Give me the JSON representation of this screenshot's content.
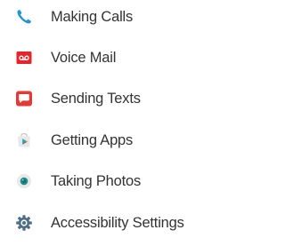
{
  "menu": {
    "items": [
      {
        "label": "Making Calls",
        "icon": "phone-icon",
        "color": "#2196d3"
      },
      {
        "label": "Voice Mail",
        "icon": "voicemail-icon",
        "color": "#e8242b"
      },
      {
        "label": "Sending Texts",
        "icon": "message-icon",
        "color": "#e53935"
      },
      {
        "label": "Getting Apps",
        "icon": "play-store-icon",
        "color": "#e8e8e8"
      },
      {
        "label": "Taking Photos",
        "icon": "camera-icon",
        "color": "#1a8e8c"
      },
      {
        "label": "Accessibility Settings",
        "icon": "gear-icon",
        "color": "#4d6f86"
      }
    ]
  }
}
